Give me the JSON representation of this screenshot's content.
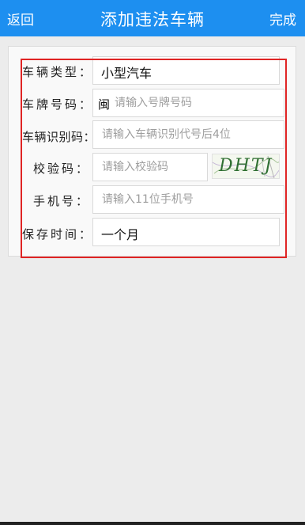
{
  "header": {
    "back_label": "返回",
    "title": "添加违法车辆",
    "done_label": "完成",
    "bar_color": "#1d8ff0"
  },
  "form": {
    "vehicle_type": {
      "label": "车辆类型：",
      "value": "小型汽车"
    },
    "plate_number": {
      "label": "车牌号码：",
      "prefix": "闽",
      "placeholder": "请输入号牌号码",
      "value": ""
    },
    "vin": {
      "label": "车辆识别码：",
      "placeholder": "请输入车辆识别代号后4位",
      "value": ""
    },
    "verify_code": {
      "label": "校验码：",
      "placeholder": "请输入校验码",
      "value": "",
      "captcha_text": "DHTJ"
    },
    "phone": {
      "label": "手机号：",
      "placeholder": "请输入11位手机号",
      "value": ""
    },
    "retention": {
      "label": "保存时间：",
      "value": "一个月"
    }
  },
  "highlight_color": "#e02424"
}
